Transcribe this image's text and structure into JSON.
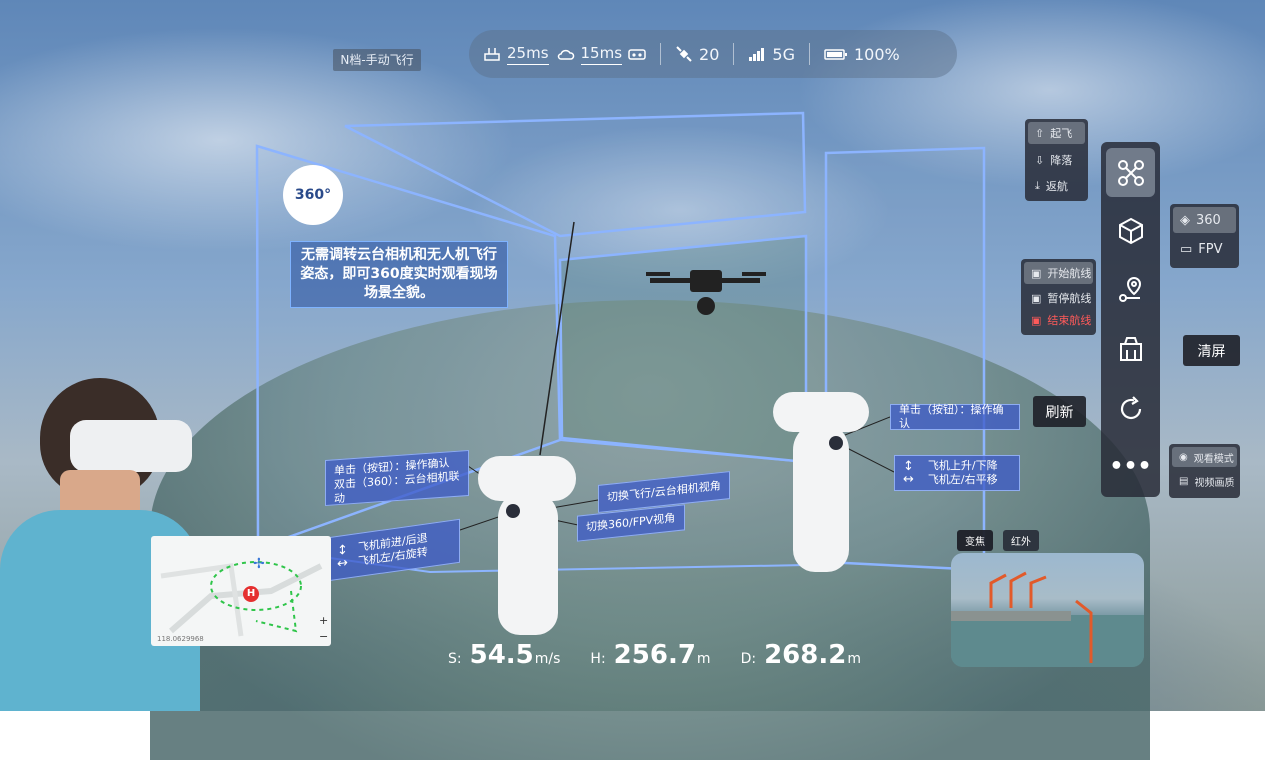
{
  "flight_mode": "N档-手动飞行",
  "status": {
    "latency_link": "25ms",
    "latency_cloud": "15ms",
    "satellites": "20",
    "network": "5G",
    "battery": "100%"
  },
  "info_text": "无需调转云台相机和无人机飞行姿态，即可360度实时观看现场场景全貌。",
  "badge_360": "360°",
  "controller_labels": {
    "left_click": "单击（按钮）：操作确认",
    "left_double": "双击（360）：云台相机联动",
    "left_stick_1": "飞机前进/后退",
    "left_stick_2": "飞机左/右旋转",
    "switch_gimbal": "切换飞行/云台相机视角",
    "switch_fpv": "切换360/FPV视角",
    "right_click": "单击（按钮）：操作确认",
    "right_stick_1": "飞机上升/下降",
    "right_stick_2": "飞机左/右平移"
  },
  "flight_menu": {
    "items": [
      "起飞",
      "降落",
      "返航"
    ]
  },
  "route_menu": {
    "items": [
      "开始航线",
      "暂停航线",
      "结束航线"
    ]
  },
  "view_menu": {
    "items": [
      "360",
      "FPV"
    ]
  },
  "watch_menu": {
    "items": [
      "观看模式",
      "视频画质"
    ]
  },
  "toolbar_tips": {
    "clear": "清屏",
    "refresh": "刷新"
  },
  "telemetry": {
    "speed_label": "S:",
    "speed_value": "54.5",
    "speed_unit": "m/s",
    "height_label": "H:",
    "height_value": "256.7",
    "height_unit": "m",
    "distance_label": "D:",
    "distance_value": "268.2",
    "distance_unit": "m"
  },
  "camera_tabs": [
    "变焦",
    "红外"
  ],
  "map": {
    "coord": "118.0629968",
    "zoom_in": "+",
    "zoom_out": "−",
    "home_marker": "H"
  },
  "colors": {
    "panel_border": "#8cb4ff",
    "label_bg": "#3c5ac8",
    "toolbar_bg": "#282c37",
    "danger": "#ff5a5a"
  }
}
